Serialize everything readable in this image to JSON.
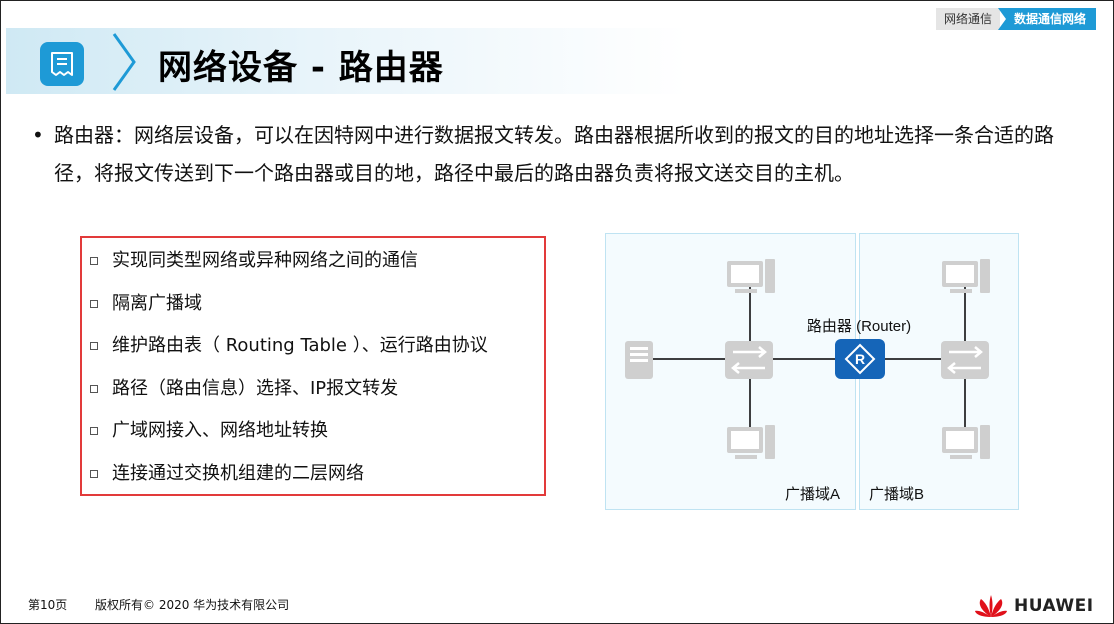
{
  "header": {
    "title": "网络设备 - 路由器",
    "breadcrumb": [
      "网络通信",
      "数据通信网络"
    ]
  },
  "main": {
    "paragraph": "路由器：网络层设备，可以在因特网中进行数据报文转发。路由器根据所收到的报文的目的地址选择一条合适的路径，将报文传送到下一个路由器或目的地，路径中最后的路由器负责将报文送交目的主机。",
    "items": [
      "实现同类型网络或异种网络之间的通信",
      "隔离广播域",
      "维护路由表（ Routing Table ）、运行路由协议",
      "路径（路由信息）选择、IP报文转发",
      "广域网接入、网络地址转换",
      "连接通过交换机组建的二层网络"
    ]
  },
  "diagram": {
    "router_label": "路由器 (Router)",
    "domain_a": "广播域A",
    "domain_b": "广播域B",
    "colors": {
      "router": "#1565b8",
      "device": "#cfcfcf",
      "domain_border": "#bfe3f2",
      "domain_fill": "#f4fbfe"
    },
    "icons": [
      "server-icon",
      "switch-icon",
      "pc-icon",
      "router-icon"
    ]
  },
  "footer": {
    "page": "第10页",
    "copyright": "版权所有© 2020 华为技术有限公司",
    "brand": "HUAWEI"
  },
  "colors": {
    "accent": "#1e9ad6",
    "highlight_box": "#e23a3a",
    "brand_red": "#e0101a"
  }
}
